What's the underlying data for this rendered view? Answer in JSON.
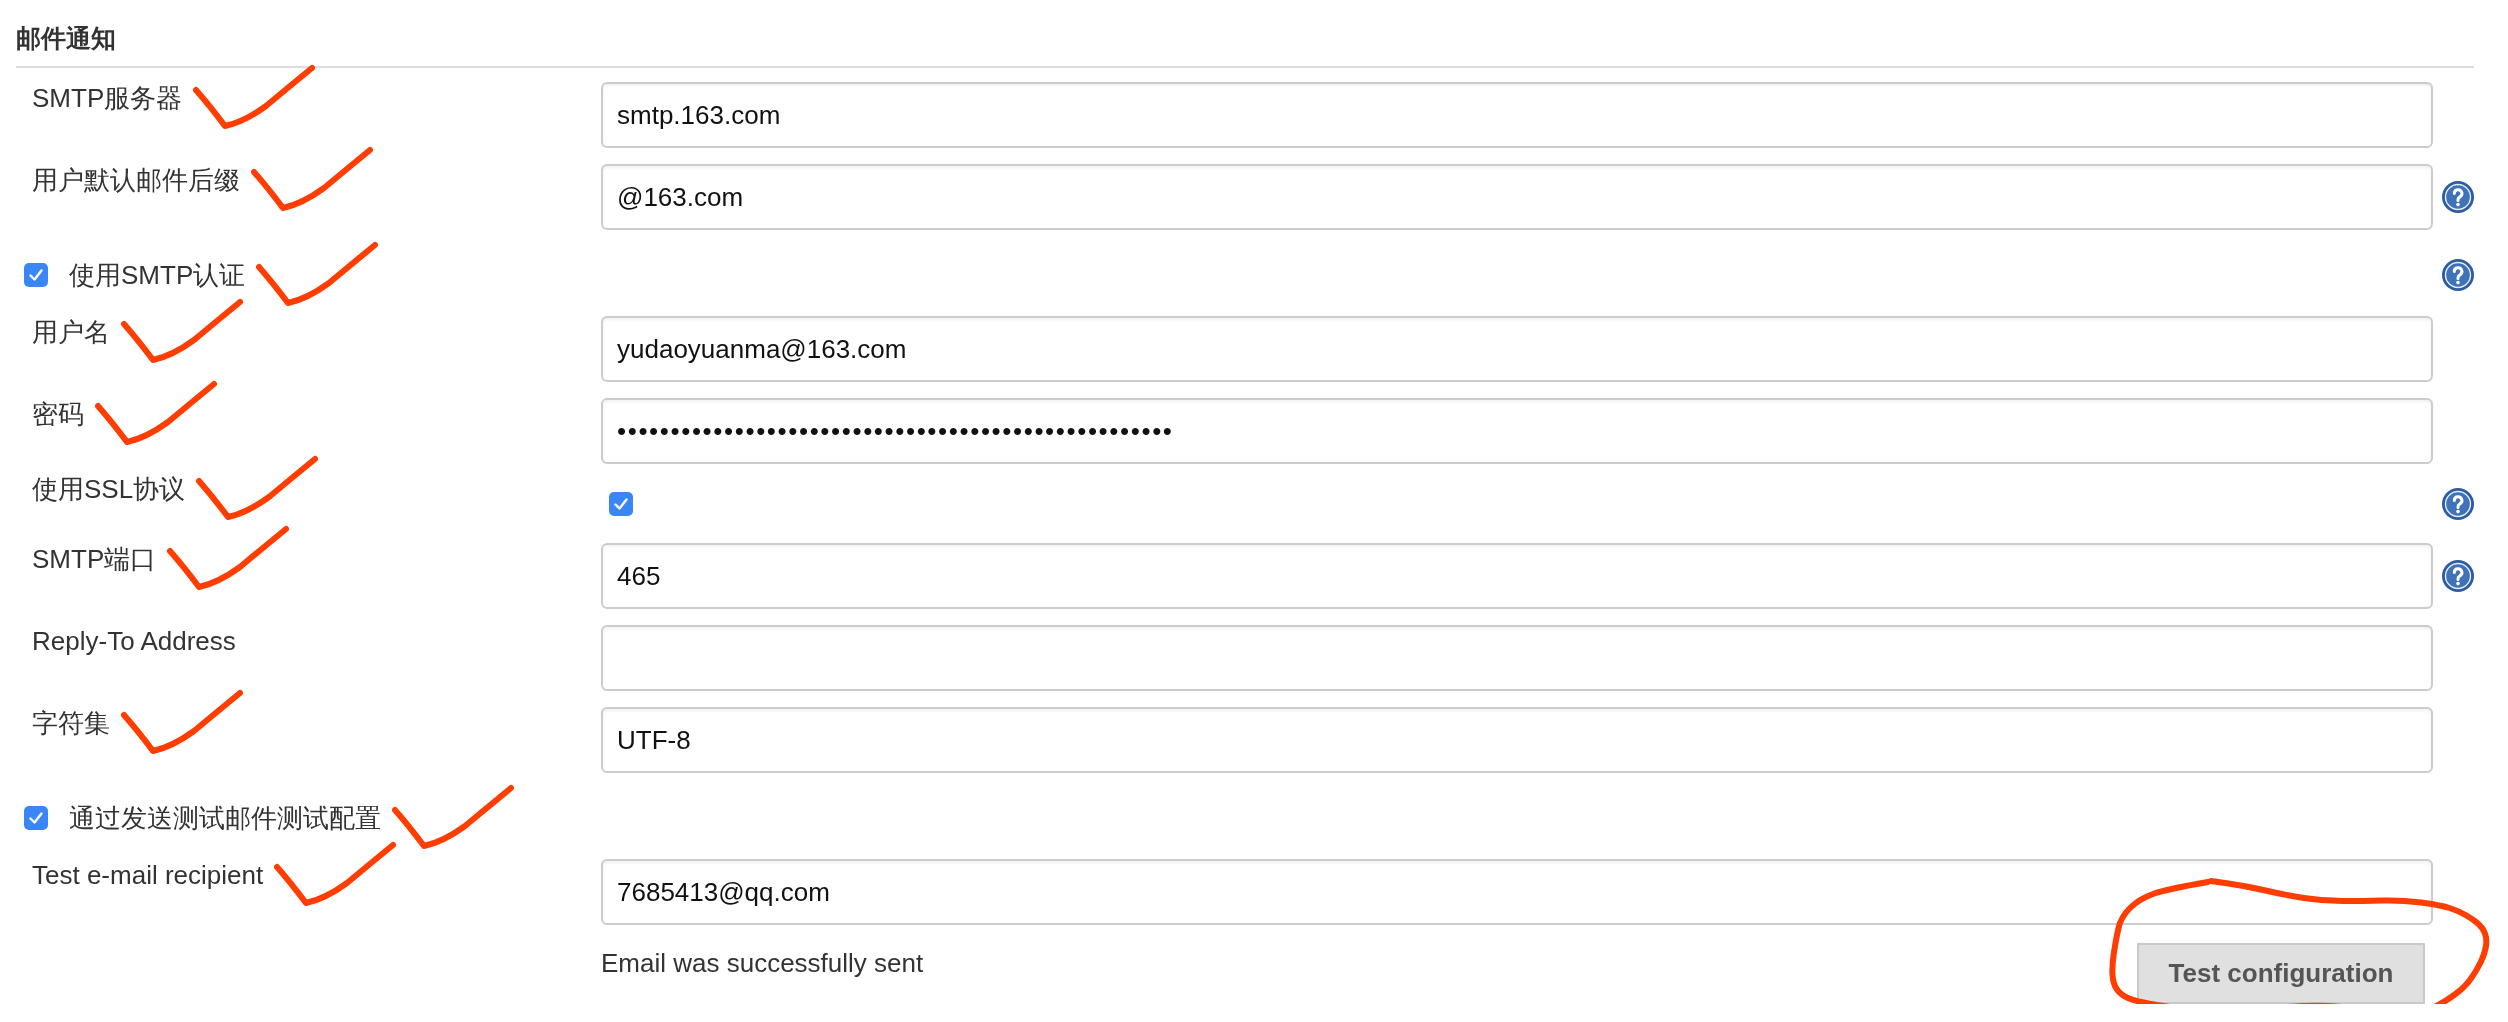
{
  "section": {
    "title": "邮件通知"
  },
  "rows": [
    {
      "kind": "text",
      "label": "SMTP服务器",
      "value": "smtp.163.com",
      "help": false,
      "marked": true
    },
    {
      "kind": "text",
      "label": "用户默认邮件后缀",
      "value": "@163.com",
      "help": true,
      "marked": true
    },
    {
      "kind": "toggle",
      "label": "使用SMTP认证",
      "checked": true,
      "help": true,
      "marked": true
    },
    {
      "kind": "text",
      "label": "用户名",
      "value": "yudaoyuanma@163.com",
      "help": false,
      "marked": true
    },
    {
      "kind": "password",
      "label": "密码",
      "value": "••••••••••••••••••••••••••••••••••••••••••••••••••••",
      "help": false,
      "marked": true
    },
    {
      "kind": "checkbox",
      "label": "使用SSL协议",
      "checked": true,
      "help": true,
      "marked": true
    },
    {
      "kind": "text",
      "label": "SMTP端口",
      "value": "465",
      "help": true,
      "marked": true
    },
    {
      "kind": "text",
      "label": "Reply-To Address",
      "help": false,
      "marked": false
    },
    {
      "kind": "text",
      "label": "字符集",
      "value": "UTF-8",
      "help": false,
      "marked": true
    },
    {
      "kind": "toggle",
      "label": "通过发送测试邮件测试配置",
      "checked": true,
      "help": false,
      "marked": true
    },
    {
      "kind": "text",
      "label": "Test e-mail recipient",
      "value": "7685413@qq.com",
      "help": false,
      "marked": true
    }
  ],
  "test": {
    "message": "Email was successfully sent",
    "button": "Test configuration",
    "circled": true
  }
}
